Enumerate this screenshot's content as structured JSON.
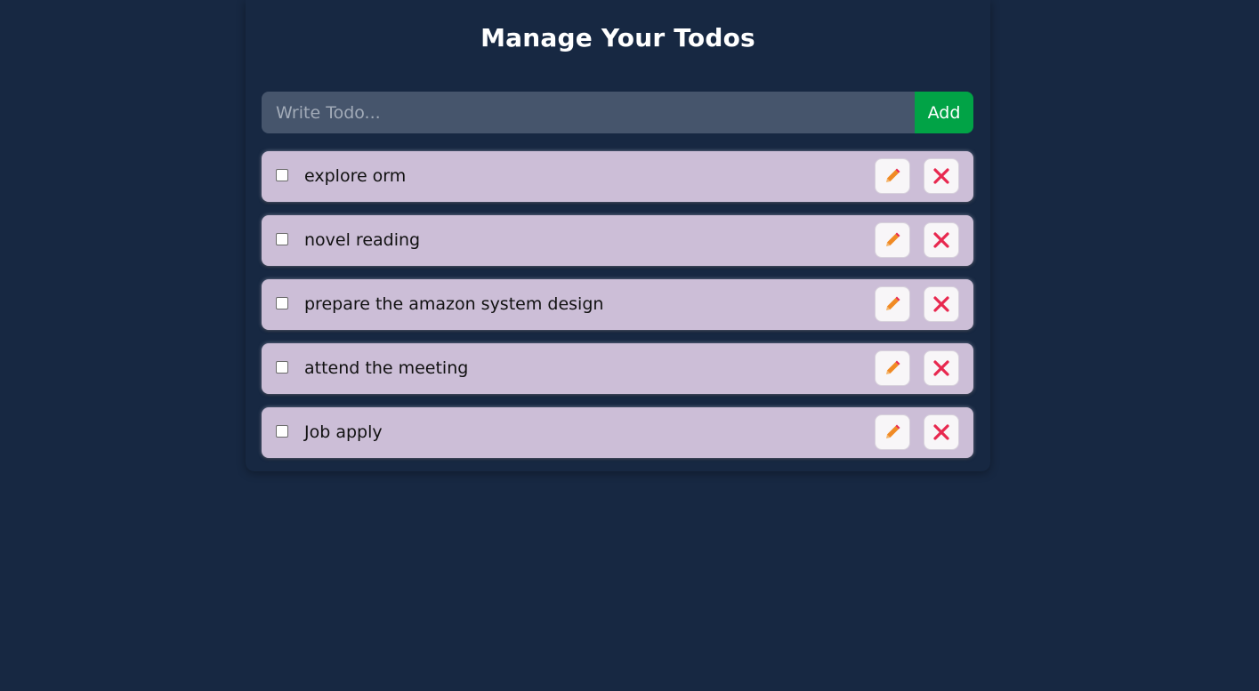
{
  "header": {
    "title": "Manage Your Todos"
  },
  "form": {
    "placeholder": "Write Todo...",
    "value": "",
    "add_label": "Add"
  },
  "todos": [
    {
      "text": "explore orm",
      "completed": false
    },
    {
      "text": "novel reading",
      "completed": false
    },
    {
      "text": "prepare the amazon system design",
      "completed": false
    },
    {
      "text": "attend the meeting",
      "completed": false
    },
    {
      "text": "Job apply",
      "completed": false
    }
  ],
  "icons": {
    "edit": "pencil-icon",
    "delete": "close-icon"
  },
  "colors": {
    "background": "#172842",
    "input_bg": "#46556c",
    "add_button": "#01a346",
    "todo_bg": "#ccbed7",
    "delete_icon": "#e8284f",
    "edit_icon": "#f08a24"
  }
}
